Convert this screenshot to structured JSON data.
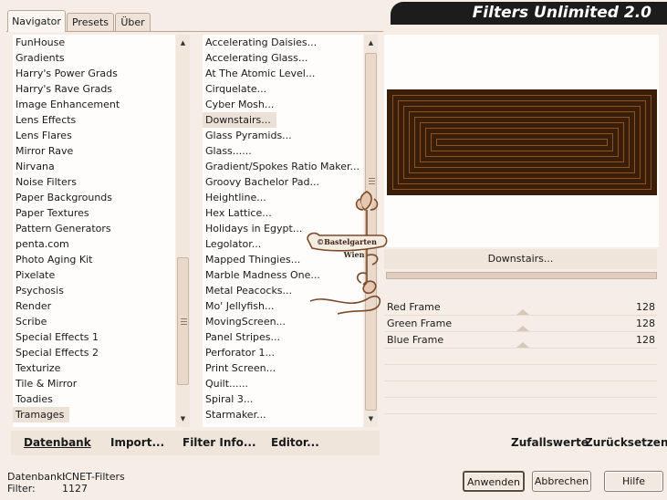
{
  "app": {
    "title": "Filters Unlimited 2.0"
  },
  "tabs": [
    {
      "label": "Navigator",
      "active": true
    },
    {
      "label": "Presets",
      "active": false
    },
    {
      "label": "Über",
      "active": false
    }
  ],
  "categories": {
    "selected": "Tramages",
    "items": [
      "FunHouse",
      "Gradients",
      "Harry's Power Grads",
      "Harry's Rave Grads",
      "Image Enhancement",
      "Lens Effects",
      "Lens Flares",
      "Mirror Rave",
      "Nirvana",
      "Noise Filters",
      "Paper Backgrounds",
      "Paper Textures",
      "Pattern Generators",
      "penta.com",
      "Photo Aging Kit",
      "Pixelate",
      "Psychosis",
      "Render",
      "Scribe",
      "Special Effects 1",
      "Special Effects 2",
      "Texturize",
      "Tile & Mirror",
      "Toadies",
      "Tramages"
    ]
  },
  "filters": {
    "selected": "Downstairs...",
    "items": [
      "Accelerating Daisies...",
      "Accelerating Glass...",
      "At The Atomic Level...",
      "Cirquelate...",
      "Cyber Mosh...",
      "Downstairs...",
      "Glass Pyramids...",
      "Glass......",
      "Gradient/Spokes Ratio Maker...",
      "Groovy Bachelor Pad...",
      "Heightline...",
      "Hex Lattice...",
      "Holidays in Egypt...",
      "Legolator...",
      "Mapped Thingies...",
      "Marble Madness One...",
      "Metal Peacocks...",
      "Mo' Jellyfish...",
      "MovingScreen...",
      "Panel Stripes...",
      "Perforator 1...",
      "Print Screen...",
      "Quilt......",
      "Spiral 3...",
      "Starmaker..."
    ]
  },
  "toolbar": {
    "database": "Datenbank",
    "import": "Import...",
    "filter_info": "Filter Info...",
    "editor": "Editor..."
  },
  "filter_name": "Downstairs...",
  "params": [
    {
      "label": "Red Frame",
      "value": "128"
    },
    {
      "label": "Green Frame",
      "value": "128"
    },
    {
      "label": "Blue Frame",
      "value": "128"
    }
  ],
  "right_toolbar": {
    "random": "Zufallswerte",
    "reset": "Zurücksetzen"
  },
  "status": {
    "db_label": "Datenbank:",
    "db_value": "ICNET-Filters",
    "filter_label": "Filter:",
    "filter_value": "1127"
  },
  "buttons": {
    "apply": "Anwenden",
    "cancel": "Abbrechen",
    "help": "Hilfe"
  },
  "watermark": {
    "line1": "©Bastelgarten",
    "line2": "Wien"
  },
  "colors": {
    "preview_bg": "#3b1e07",
    "preview_line": "#8a5426",
    "banner": "#1c1c1c",
    "background": "#f6eee6"
  }
}
